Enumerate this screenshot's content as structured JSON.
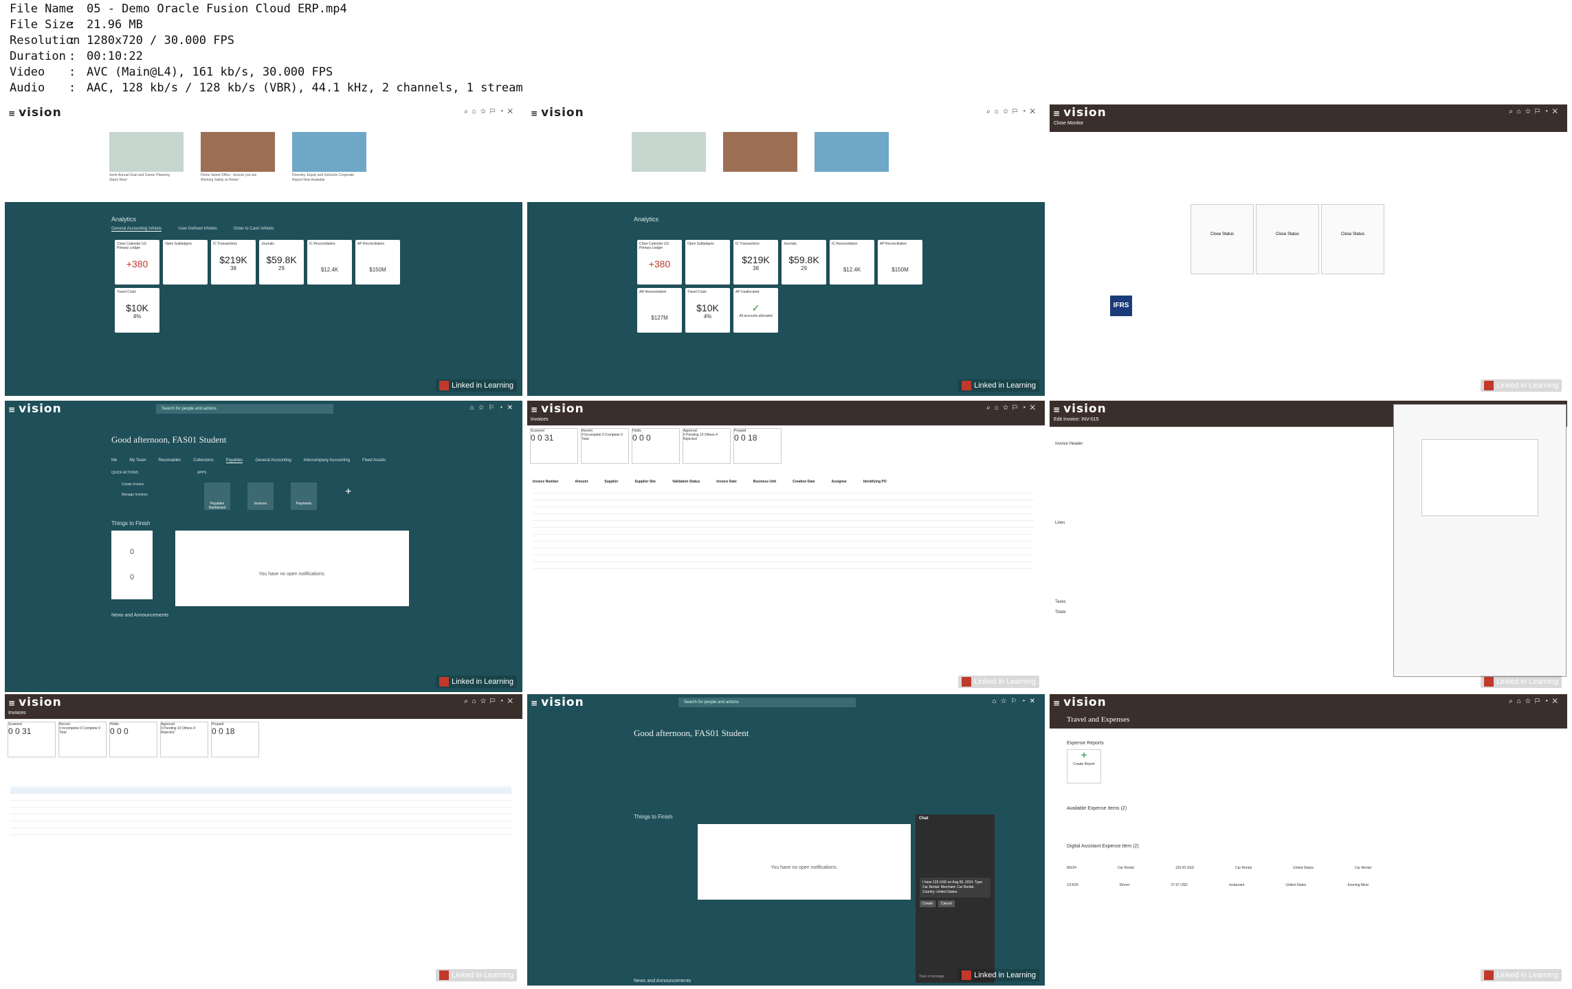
{
  "meta": {
    "rows": [
      {
        "key": "File Name",
        "value": "05 - Demo Oracle Fusion Cloud ERP.mp4"
      },
      {
        "key": "File Size",
        "value": "21.96 MB"
      },
      {
        "key": "Resolution",
        "value": "1280x720 / 30.000 FPS"
      },
      {
        "key": "Duration",
        "value": "00:10:22"
      },
      {
        "key": "Video",
        "value": "AVC (Main@L4), 161 kb/s, 30.000 FPS"
      },
      {
        "key": "Audio",
        "value": "AAC, 128 kb/s / 128 kb/s (VBR), 44.1 kHz, 2 channels, 1 stream"
      }
    ]
  },
  "common": {
    "logo": "vision",
    "watermark": "Linked in Learning"
  },
  "frame1": {
    "analytics_title": "Analytics",
    "tabs": [
      "General Accounting Infolets",
      "User-Defined Infolets",
      "Order to Cash Infolets"
    ],
    "articles": [
      "Semi-Annual Goal and Career Planning Starts Now!",
      "Home Sweet Office - Ensure you are Working Safely at Home!",
      "Diversity, Equity and Inclusion Corporate Report Now Available"
    ],
    "tiles": [
      {
        "title": "Close Calendar US Primary Ledger",
        "big": "+380",
        "sub": ""
      },
      {
        "title": "Open Subledgers",
        "big": "",
        "sub": ""
      },
      {
        "title": "IC Transactions",
        "big": "$219K",
        "sub": "38"
      },
      {
        "title": "Journals",
        "big": "$59.8K",
        "sub": "29"
      },
      {
        "title": "IC Reconciliation",
        "big": "$12.4K",
        "sub": ""
      },
      {
        "title": "AP Reconciliation",
        "big": "$150M",
        "sub": ""
      },
      {
        "title": "Travel Costs",
        "big": "$10K",
        "sub": "4%"
      }
    ]
  },
  "frame2": {
    "analytics_title": "Analytics",
    "tiles": [
      {
        "title": "Close Calendar US Primary Ledger",
        "big": "+380",
        "sub": ""
      },
      {
        "title": "Open Subledgers",
        "big": "",
        "sub": ""
      },
      {
        "title": "IC Transactions",
        "big": "$219K",
        "sub": "38"
      },
      {
        "title": "Journals",
        "big": "$59.8K",
        "sub": "29"
      },
      {
        "title": "IC Reconciliation",
        "big": "$12.4K",
        "sub": ""
      },
      {
        "title": "AP Reconciliation",
        "big": "$150M",
        "sub": ""
      },
      {
        "title": "AR Reconciliation",
        "big": "$127M",
        "sub": ""
      },
      {
        "title": "Travel Costs",
        "big": "$10K",
        "sub": "4%"
      },
      {
        "title": "AP Unallocated",
        "big": "✓",
        "sub": "All accounts allocated"
      }
    ]
  },
  "frame3": {
    "title": "Close Monitor",
    "nodes": [
      "Close Status",
      "Close Status",
      "Close Status"
    ],
    "badge": "IFRS"
  },
  "frame4": {
    "search_placeholder": "Search for people and actions",
    "greeting": "Good afternoon, FAS01 Student",
    "nav": [
      "Me",
      "My Team",
      "Receivables",
      "Collections",
      "Payables",
      "General Accounting",
      "Intercompany Accounting",
      "Fixed Assets"
    ],
    "quick_actions_label": "QUICK ACTIONS",
    "quick_actions": [
      "Create Invoice",
      "Manage Invoices"
    ],
    "apps_label": "APPS",
    "apps": [
      "Payables Dashboard",
      "Invoices",
      "Payments"
    ],
    "things_title": "Things to Finish",
    "assigned": "0",
    "created": "0",
    "no_notifications": "You have no open notifications.",
    "news": "News and Announcements"
  },
  "frame5": {
    "title": "Invoices",
    "boxes": [
      {
        "label": "Scanned",
        "values": "0  0  31"
      },
      {
        "label": "Recent",
        "values": "0 Incomplete  0 Complete  0 Total"
      },
      {
        "label": "Holds",
        "values": "0  0  0"
      },
      {
        "label": "Approval",
        "values": "0 Pending  10 Others  4 Rejected"
      },
      {
        "label": "Prepaid",
        "values": "0  0  18"
      }
    ],
    "headers": [
      "Invoice Number",
      "Amount",
      "Supplier",
      "Supplier Site",
      "Validation Status",
      "Invoice Date",
      "Business Unit",
      "Creation Date",
      "Assignee",
      "Identifying PO"
    ]
  },
  "frame6": {
    "title": "Edit Invoice: INV-015",
    "header_section": "Invoice Header",
    "lines_section": "Lines",
    "taxes": "Taxes",
    "totals": "Totals"
  },
  "frame8": {
    "greeting": "Good afternoon, FAS01 Student",
    "chat_title": "Chat",
    "chat_message": "I have 125 USD on Aug 06, 2024. Type: Car Rental. Merchant: Car Rental. Country: United States.",
    "chat_buttons": [
      "Create",
      "Cancel"
    ],
    "chat_input": "Type a message",
    "no_notifications": "You have no open notifications.",
    "things_title": "Things to Finish",
    "news": "News and Announcements"
  },
  "frame9": {
    "title": "Travel and Expenses",
    "reports_label": "Expense Reports",
    "create_report": "Create Report",
    "available": "Available Expense Items (2)",
    "assistant": "Digital Assistant Expense Item (2)",
    "rows": [
      {
        "date": "8/6/24",
        "type": "Car Rental",
        "amount": "125.00 USD",
        "merchant": "Car Rental",
        "location": "United States",
        "description": "Car Rental"
      },
      {
        "date": "1/14/25",
        "type": "Dinner",
        "amount": "27.97 USD",
        "merchant": "restaurant",
        "location": "United States",
        "description": "Evening Meal"
      }
    ]
  }
}
